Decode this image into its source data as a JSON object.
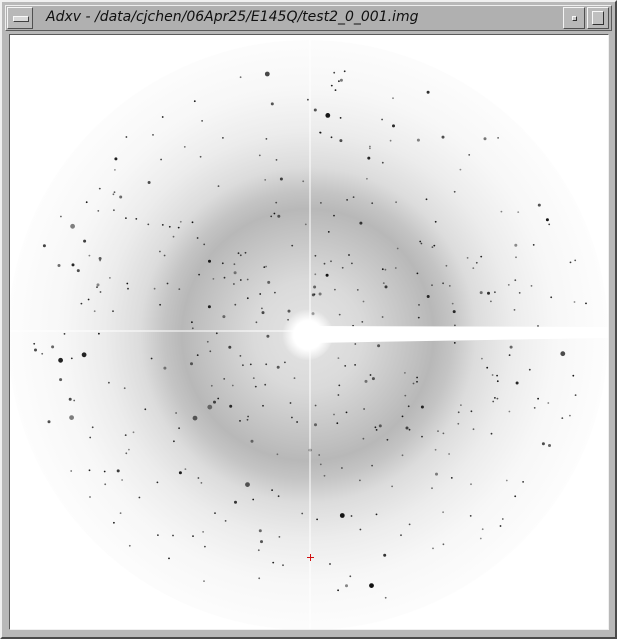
{
  "window": {
    "title": "Adxv - /data/cjchen/06Apr25/E145Q/test2_0_001.img"
  },
  "icons": {
    "menu": "window-menu-icon",
    "minimize": "minimize-icon",
    "maximize": "maximize-icon",
    "beam_center": "beam-center-cross-icon"
  },
  "colors": {
    "crosshair": "#ffffff",
    "beam_center_marker": "#d01010",
    "diffraction_spot": "#101010",
    "background": "#ffffff"
  }
}
